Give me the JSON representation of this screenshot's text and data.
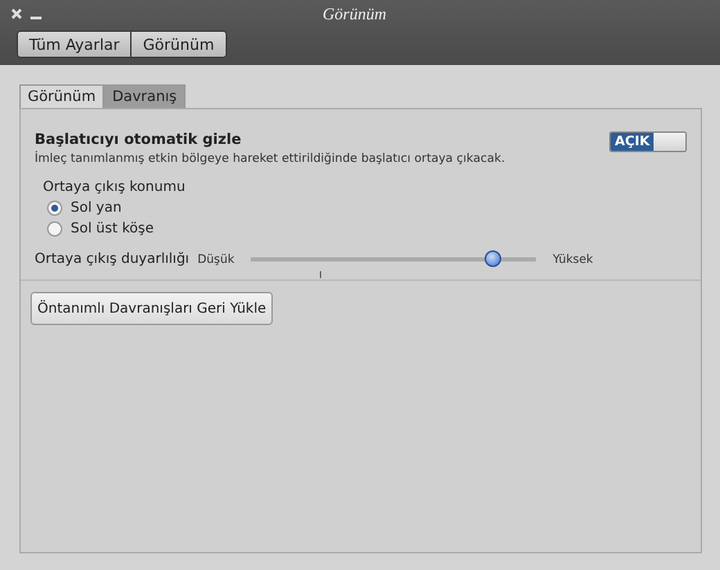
{
  "window": {
    "title": "Görünüm"
  },
  "toolbar": [
    {
      "label": "Tüm Ayarlar",
      "selected": false
    },
    {
      "label": "Görünüm",
      "selected": false
    }
  ],
  "tabs": [
    {
      "label": "Görünüm",
      "selected": false
    },
    {
      "label": "Davranış",
      "selected": true
    }
  ],
  "autohide": {
    "title": "Başlatıcıyı otomatik gizle",
    "description": "İmleç tanımlanmış etkin bölgeye hareket ettirildiğinde başlatıcı ortaya çıkacak.",
    "switch_label": "AÇIK",
    "on": true
  },
  "position": {
    "label": "Ortaya çıkış konumu",
    "options": [
      {
        "label": "Sol yan",
        "selected": true
      },
      {
        "label": "Sol üst köşe",
        "selected": false
      }
    ]
  },
  "sensitivity": {
    "label": "Ortaya çıkış duyarlılığı",
    "min_label": "Düşük",
    "max_label": "Yüksek",
    "level": 0.87
  },
  "reset_button": "Öntanımlı Davranışları Geri Yükle"
}
